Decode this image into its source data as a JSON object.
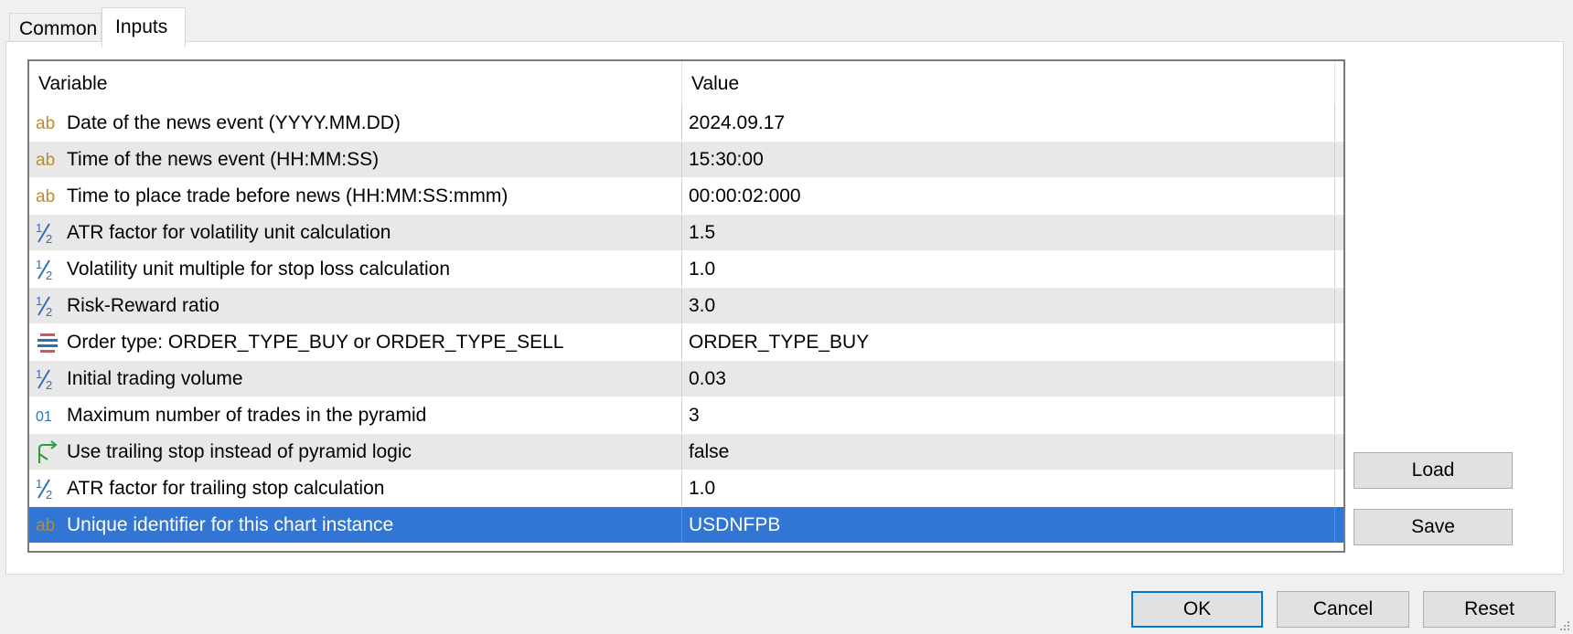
{
  "tabs": [
    {
      "label": "Common"
    },
    {
      "label": "Inputs"
    }
  ],
  "table": {
    "columns": {
      "variable": "Variable",
      "value": "Value"
    },
    "rows": [
      {
        "icon": "string-icon",
        "variable": "Date of the news event (YYYY.MM.DD)",
        "value": "2024.09.17"
      },
      {
        "icon": "string-icon",
        "variable": "Time of the news event (HH:MM:SS)",
        "value": "15:30:00"
      },
      {
        "icon": "string-icon",
        "variable": "Time to place trade before news (HH:MM:SS:mmm)",
        "value": "00:00:02:000"
      },
      {
        "icon": "fraction-icon",
        "variable": "ATR factor for volatility unit calculation",
        "value": "1.5"
      },
      {
        "icon": "fraction-icon",
        "variable": "Volatility unit multiple for stop loss calculation",
        "value": "1.0"
      },
      {
        "icon": "fraction-icon",
        "variable": "Risk-Reward ratio",
        "value": "3.0"
      },
      {
        "icon": "enum-icon",
        "variable": "Order type: ORDER_TYPE_BUY or ORDER_TYPE_SELL",
        "value": "ORDER_TYPE_BUY"
      },
      {
        "icon": "fraction-icon",
        "variable": "Initial trading volume",
        "value": "0.03"
      },
      {
        "icon": "integer-icon",
        "variable": "Maximum number of trades in the pyramid",
        "value": "3"
      },
      {
        "icon": "boolean-icon",
        "variable": "Use trailing stop instead of pyramid logic",
        "value": "false"
      },
      {
        "icon": "fraction-icon",
        "variable": "ATR factor for trailing stop calculation",
        "value": "1.0"
      },
      {
        "icon": "string-icon",
        "variable": "Unique identifier for this chart instance",
        "value": "USDNFPB",
        "selected": true
      }
    ]
  },
  "side_buttons": {
    "load": "Load",
    "save": "Save"
  },
  "dialog_buttons": {
    "ok": "OK",
    "cancel": "Cancel",
    "reset": "Reset"
  },
  "colors": {
    "selection": "#3175d5",
    "string_icon": "#c08a2a",
    "number_icon": "#2f6fb8",
    "bool_icon": "#2e9b3a"
  }
}
